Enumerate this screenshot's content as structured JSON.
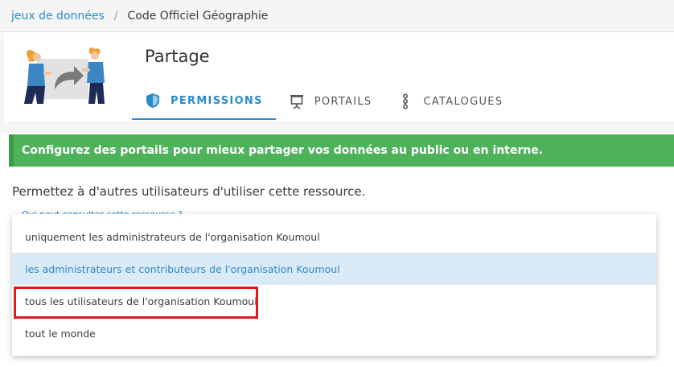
{
  "breadcrumb": {
    "link": "jeux de données",
    "separator": "/",
    "current": "Code Officiel Géographie"
  },
  "header": {
    "title": "Partage",
    "tabs": [
      {
        "label": "PERMISSIONS",
        "icon": "shield-icon",
        "active": true
      },
      {
        "label": "PORTAILS",
        "icon": "presentation-board-icon",
        "active": false
      },
      {
        "label": "CATALOGUES",
        "icon": "vertical-nodes-icon",
        "active": false
      }
    ]
  },
  "banner": {
    "text": "Configurez des portails pour mieux partager vos données au public ou en interne."
  },
  "permissions": {
    "intro": "Permettez à d'autres utilisateurs d'utiliser cette ressource.",
    "question": "Qui peut consulter cette ressource ?",
    "options": [
      {
        "label": "uniquement les administrateurs de l'organisation Koumoul",
        "selected": false
      },
      {
        "label": "les administrateurs et contributeurs de l'organisation Koumoul",
        "selected": true
      },
      {
        "label": "tous les utilisateurs de l'organisation Koumoul",
        "selected": false,
        "highlighted": true
      },
      {
        "label": "tout le monde",
        "selected": false
      }
    ]
  },
  "colors": {
    "accent": "#2a8bc8",
    "banner": "#4db25a",
    "highlight": "#e01a1a",
    "selected_bg": "#dbeaf7"
  }
}
